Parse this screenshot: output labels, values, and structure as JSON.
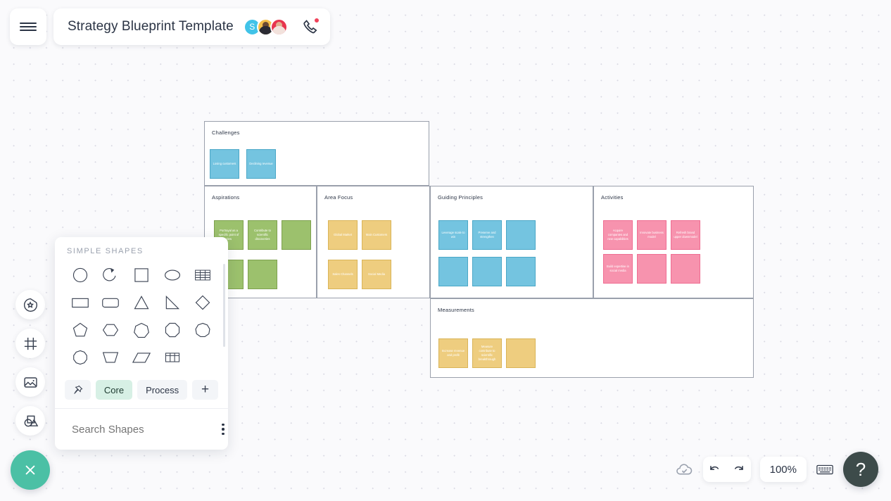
{
  "app": {
    "title": "Strategy Blueprint Template",
    "menu_icon": "hamburger-icon",
    "phone_icon": "phone-icon"
  },
  "collaborators": [
    {
      "initial": "S",
      "color": "#41c3e8",
      "type": "initial"
    },
    {
      "initial": "",
      "color": "#f5c04a",
      "type": "photo"
    },
    {
      "initial": "",
      "color": "#e8354e",
      "type": "photo"
    }
  ],
  "left_rail": [
    {
      "name": "shapes-library-icon",
      "label": "Shapes Library"
    },
    {
      "name": "frame-icon",
      "label": "Frame"
    },
    {
      "name": "image-icon",
      "label": "Image"
    },
    {
      "name": "shape-tools-icon",
      "label": "Shape Tools"
    }
  ],
  "close_button": {
    "icon": "close-icon",
    "color": "#4bc0a5"
  },
  "shapes_panel": {
    "header": "SIMPLE SHAPES",
    "search_placeholder": "Search Shapes",
    "more_icon": "kebab-menu-icon",
    "tabs": [
      {
        "label": "",
        "icon": "pin-icon",
        "active": false
      },
      {
        "label": "Core",
        "active": true
      },
      {
        "label": "Process",
        "active": false
      },
      {
        "label": "+",
        "active": false
      }
    ],
    "shapes": [
      "circle",
      "arc",
      "square",
      "ellipse",
      "table-rows",
      "rectangle",
      "rounded-rectangle",
      "triangle",
      "right-triangle",
      "diamond",
      "pentagon",
      "hexagon",
      "heptagon",
      "octagon",
      "nonagon",
      "decagon",
      "trapezoid",
      "parallelogram",
      "table-grid"
    ]
  },
  "board": {
    "sections": [
      {
        "title": "Challenges",
        "color": "blue",
        "notes": [
          "Losing customers",
          "Declining revenue"
        ]
      },
      {
        "title": "Aspirations",
        "color": "green",
        "notes": [
          "Portrayal as a specific point of view",
          "Contribute to scientific discoveries",
          "",
          "",
          ""
        ]
      },
      {
        "title": "Area Focus",
        "color": "yellow",
        "notes": [
          "Global Market",
          "Main Customers",
          "Sales Channels",
          "Social Media"
        ]
      },
      {
        "title": "Guiding Principles",
        "color": "blue",
        "notes": [
          "Leverage scale to win",
          "Preserve and strengthen",
          "",
          "",
          "",
          ""
        ]
      },
      {
        "title": "Activities",
        "color": "pink",
        "notes": [
          "Acquire companies and new capabilities",
          "Innovate business model",
          "Refresh brand upper downmodel",
          "Build expertise in social media",
          "",
          ""
        ]
      },
      {
        "title": "Measurements",
        "color": "yellow",
        "notes": [
          "Increase revenue and profit",
          "Measure contribute to scientific breakthrough",
          ""
        ]
      }
    ]
  },
  "bottom_bar": {
    "save_status_icon": "cloud-check-icon",
    "undo_icon": "undo-icon",
    "redo_icon": "redo-icon",
    "zoom_level": "100%",
    "keyboard_icon": "keyboard-icon",
    "help_label": "?"
  }
}
